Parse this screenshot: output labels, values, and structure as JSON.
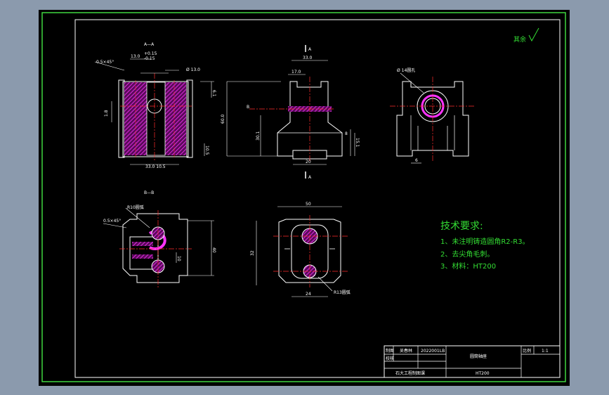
{
  "drawing": {
    "colors": {
      "background": "#000000",
      "frame": "#ffffff",
      "outer_frame": "#3fd63f",
      "hatch": "#ff33ff",
      "centerline": "#ff2b2b",
      "notes": "#33dd33"
    },
    "section_aa_label": "A—A",
    "section_bb_label": "B—B",
    "marker_a": "A",
    "marker_b": "B",
    "roughness_note": "其余",
    "dims": {
      "aa_chamfer": "0.5×45°",
      "aa_top": "13.0",
      "aa_tol_plus": "+0.15",
      "aa_tol_minus": "-0.15",
      "aa_dia": "Ø 13.0",
      "aa_right": "6.1",
      "aa_left": "1.8",
      "aa_bottom_right": "10.5",
      "aa_bottom": "33.0 10.5",
      "side_top": "33.0",
      "side_mid": "17.0",
      "side_height": "60.0",
      "side_inner": "30.1",
      "side_b": "8",
      "side_right": "15.1",
      "side_bottom": "20",
      "front_dia": "Ø 14圆孔",
      "front_bottom": "6",
      "bb_chamfer": "0.5×45°",
      "bb_hole": "R10圆弧",
      "bb_height": "40",
      "bb_small": "10",
      "bot_width": "50",
      "bot_height": "32",
      "bot_bottom": "24",
      "bot_r": "R13圆弧"
    },
    "notes": {
      "title": "技术要求:",
      "items": [
        "1、未注明铸造圆角R2-R3。",
        "2、去尖角毛刺。",
        "3、材料：HT200"
      ]
    },
    "title_block": {
      "drawn_by_label": "制图",
      "drawn_by": "吴春林",
      "student_id": "2022001LB",
      "checked_label": "校核",
      "part_name": "圆筒轴座",
      "scale_label": "比例",
      "scale": "1:1",
      "school": "石大工程制图课",
      "material": "HT200"
    }
  }
}
